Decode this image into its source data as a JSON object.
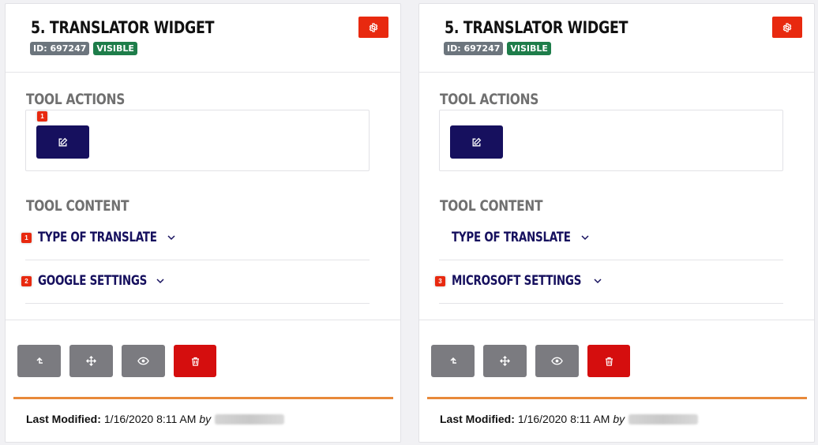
{
  "cards": [
    {
      "title": "5. TRANSLATOR WIDGET",
      "id_badge": "ID: 697247",
      "status_badge": "VISIBLE",
      "tool_actions_label": "TOOL ACTIONS",
      "tool_content_label": "TOOL CONTENT",
      "edit_badge": "1",
      "accordion": [
        {
          "badge": "1",
          "label": "TYPE OF TRANSLATE"
        },
        {
          "badge": "2",
          "label": "GOOGLE SETTINGS"
        }
      ],
      "last_modified_label": "Last Modified:",
      "last_modified_value": "1/16/2020 8:11 AM",
      "by_label": "by"
    },
    {
      "title": "5. TRANSLATOR WIDGET",
      "id_badge": "ID: 697247",
      "status_badge": "VISIBLE",
      "tool_actions_label": "TOOL ACTIONS",
      "tool_content_label": "TOOL CONTENT",
      "accordion": [
        {
          "label": "TYPE OF TRANSLATE"
        },
        {
          "badge": "3",
          "label": "MICROSOFT SETTINGS"
        }
      ],
      "last_modified_label": "Last Modified:",
      "last_modified_value": "1/16/2020 8:11 AM",
      "by_label": "by"
    }
  ],
  "icons": {
    "settings": "gear-icon",
    "edit": "edit-icon",
    "move_up": "level-up-icon",
    "move": "move-arrows-icon",
    "preview": "eye-icon",
    "delete": "trash-icon",
    "expand": "chevron-down-icon"
  },
  "colors": {
    "accent_red": "#e8290f",
    "navy": "#16105e",
    "visible_green": "#1e7d4a",
    "id_gray": "#6c757d",
    "button_gray": "#7b7b80",
    "delete_red": "#d50e0e",
    "divider_orange": "#e8893a"
  }
}
